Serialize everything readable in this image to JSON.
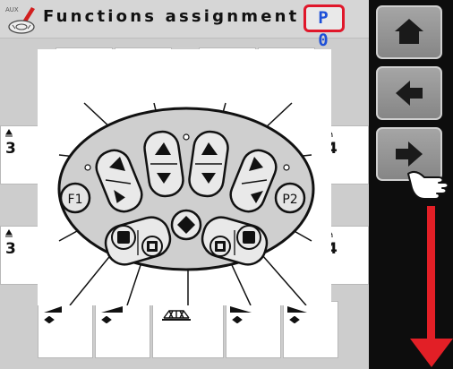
{
  "header": {
    "title": "Functions assignment",
    "program_badge": "P 0",
    "app_icon": "aux-joystick-icon"
  },
  "joystick": {
    "left_side_button": "F1",
    "right_side_button": "P2"
  },
  "tiles": {
    "top": [
      {
        "icon": "raise-lower-icon"
      },
      {
        "icon": "raise-lower-icon"
      },
      {
        "icon": "tilt-icon"
      },
      {
        "icon": "tilt-icon"
      }
    ],
    "left": [
      {
        "icon": "raise-lower-icon",
        "number": "3"
      },
      {
        "icon": "raise-lower-icon",
        "number": "3"
      }
    ],
    "right": [
      {
        "icon": "raise-lower-icon",
        "number": "4"
      },
      {
        "icon": "raise-lower-icon",
        "number": "4"
      }
    ],
    "bottom": [
      {
        "icon": "left-boom-fold-icon"
      },
      {
        "icon": "left-boom-fold-icon"
      },
      {
        "icon": "boom-fold-icon"
      },
      {
        "icon": "right-boom-fold-icon"
      },
      {
        "icon": "right-boom-fold-icon"
      }
    ]
  },
  "nav": {
    "home": "home-icon",
    "back": "arrow-left-icon",
    "next": "arrow-right-icon",
    "scroll_hint": "arrow-down-icon",
    "accent_color": "#e21f26"
  }
}
